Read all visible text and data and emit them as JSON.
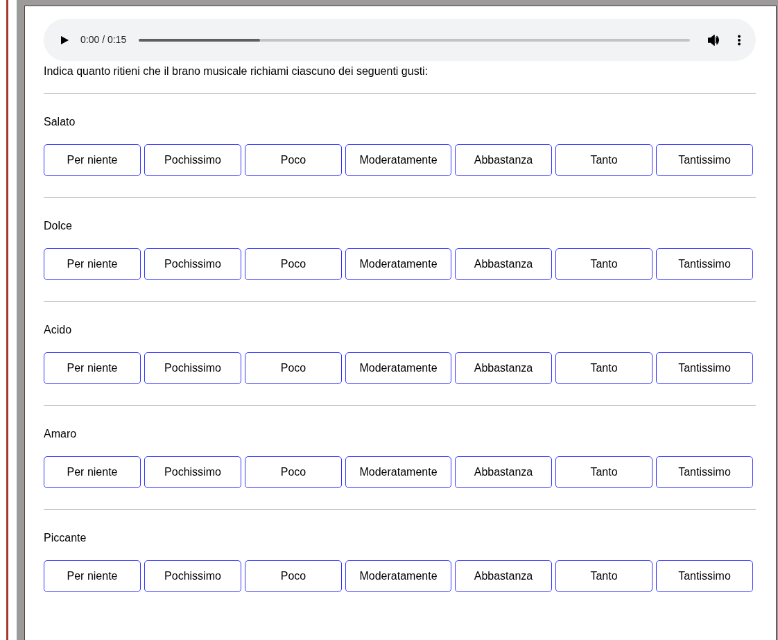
{
  "audio_player": {
    "time": "0:00 / 0:15",
    "level": 0.22
  },
  "instruction": "Indica quanto ritieni che il brano musicale richiami ciascuno dei seguenti gusti:",
  "questions": [
    {
      "label": "Salato",
      "options": [
        {
          "label": "Per niente",
          "selected": false
        },
        {
          "label": "Pochissimo",
          "selected": false
        },
        {
          "label": "Poco",
          "selected": false
        },
        {
          "label": "Moderatamente",
          "selected": false
        },
        {
          "label": "Abbastanza",
          "selected": false
        },
        {
          "label": "Tanto",
          "selected": false
        },
        {
          "label": "Tantissimo",
          "selected": false
        }
      ]
    },
    {
      "label": "Dolce",
      "options": [
        {
          "label": "Per niente",
          "selected": false
        },
        {
          "label": "Pochissimo",
          "selected": false
        },
        {
          "label": "Poco",
          "selected": false
        },
        {
          "label": "Moderatamente",
          "selected": false
        },
        {
          "label": "Abbastanza",
          "selected": false
        },
        {
          "label": "Tanto",
          "selected": false
        },
        {
          "label": "Tantissimo",
          "selected": false
        }
      ]
    },
    {
      "label": "Acido",
      "options": [
        {
          "label": "Per niente",
          "selected": false
        },
        {
          "label": "Pochissimo",
          "selected": false
        },
        {
          "label": "Poco",
          "selected": false
        },
        {
          "label": "Moderatamente",
          "selected": false
        },
        {
          "label": "Abbastanza",
          "selected": false
        },
        {
          "label": "Tanto",
          "selected": false
        },
        {
          "label": "Tantissimo",
          "selected": false
        }
      ]
    },
    {
      "label": "Amaro",
      "options": [
        {
          "label": "Per niente",
          "selected": false
        },
        {
          "label": "Pochissimo",
          "selected": false
        },
        {
          "label": "Poco",
          "selected": false
        },
        {
          "label": "Moderatamente",
          "selected": false
        },
        {
          "label": "Abbastanza",
          "selected": false
        },
        {
          "label": "Tanto",
          "selected": false
        },
        {
          "label": "Tantissimo",
          "selected": false
        }
      ]
    },
    {
      "label": "Piccante",
      "options": [
        {
          "label": "Per niente",
          "selected": false
        },
        {
          "label": "Pochissimo",
          "selected": false
        },
        {
          "label": "Poco",
          "selected": false
        },
        {
          "label": "Moderatamente",
          "selected": false
        },
        {
          "label": "Abbastanza",
          "selected": false
        },
        {
          "label": "Tanto",
          "selected": false
        },
        {
          "label": "Tantissimo",
          "selected": false
        }
      ]
    }
  ]
}
